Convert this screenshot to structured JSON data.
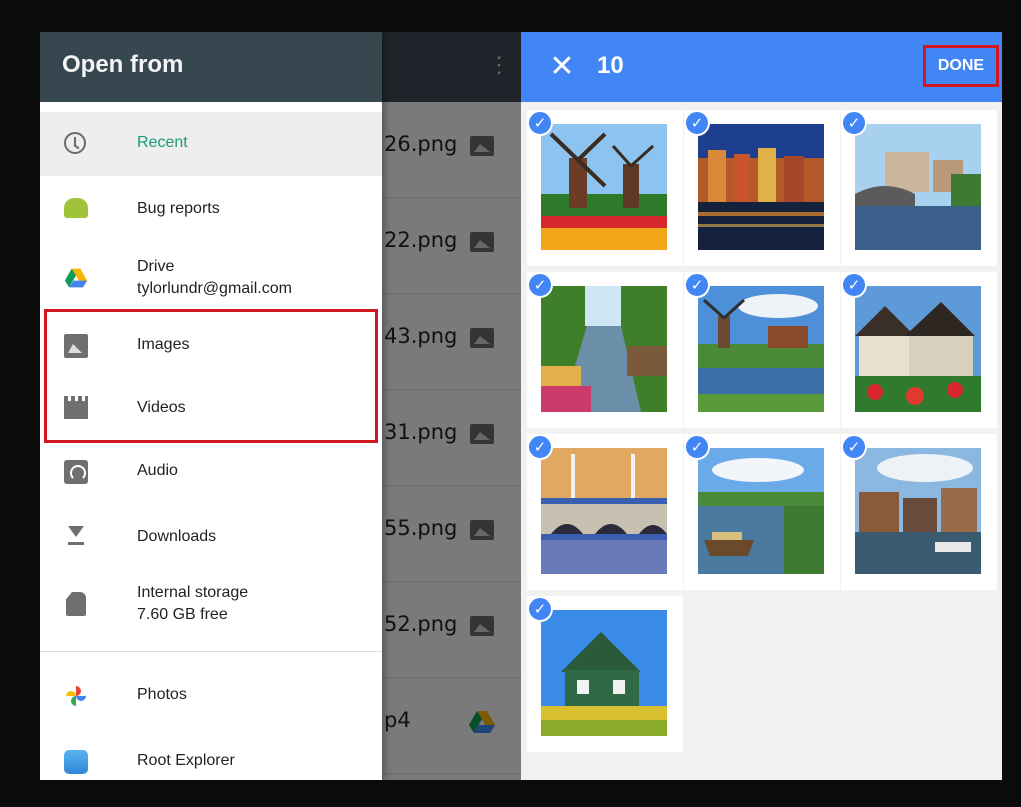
{
  "drawer": {
    "title": "Open from",
    "items": [
      {
        "label": "Recent",
        "icon": "clock-icon"
      },
      {
        "label": "Bug reports",
        "icon": "android-icon"
      },
      {
        "label": "Drive",
        "sub": "tylorlundr@gmail.com",
        "icon": "drive-icon"
      },
      {
        "label": "Images",
        "icon": "image-icon"
      },
      {
        "label": "Videos",
        "icon": "video-icon"
      },
      {
        "label": "Audio",
        "icon": "audio-icon"
      },
      {
        "label": "Downloads",
        "icon": "download-icon"
      },
      {
        "label": "Internal storage",
        "sub": "7.60 GB free",
        "icon": "sd-card-icon"
      },
      {
        "label": "Photos",
        "icon": "photos-icon"
      },
      {
        "label": "Root Explorer",
        "icon": "root-explorer-icon"
      }
    ]
  },
  "background_list": {
    "files": [
      "26.png",
      "22.png",
      "43.png",
      "31.png",
      "55.png",
      "52.png",
      "p4"
    ]
  },
  "picker": {
    "close_symbol": "✕",
    "selected_count": "10",
    "done_label": "DONE",
    "check_symbol": "✓",
    "photos": [
      "windmills-tulips",
      "canal-night",
      "canal-bridge",
      "tree-lined-canal",
      "windmill-river",
      "thatched-houses",
      "drawbridge",
      "boat-canal",
      "canal-houses",
      "green-house"
    ]
  },
  "colors": {
    "drawer_header": "#37474f",
    "active_label": "#1a9a78",
    "picker_bar": "#4285f4",
    "highlight": "#d0161f"
  }
}
